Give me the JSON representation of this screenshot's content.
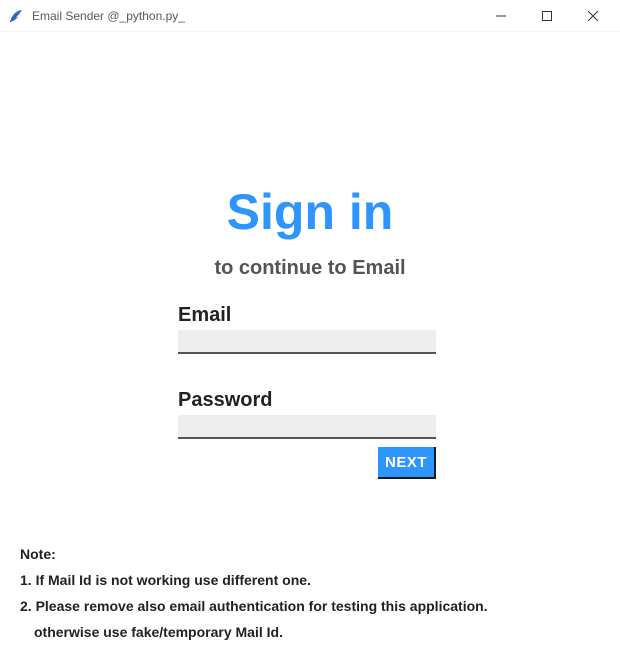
{
  "window": {
    "title": "Email Sender @_python.py_"
  },
  "form": {
    "heading": "Sign in",
    "subheading": "to continue to Email",
    "email_label": "Email",
    "email_value": "",
    "password_label": "Password",
    "password_value": "",
    "next_button": "NEXT"
  },
  "notes": {
    "heading": "Note:",
    "line1": "1. If Mail Id is not working use different one.",
    "line2": "2. Please remove also email authentication for testing this application.",
    "line3": "otherwise use fake/temporary Mail Id."
  },
  "colors": {
    "accent": "#2d95fc"
  }
}
